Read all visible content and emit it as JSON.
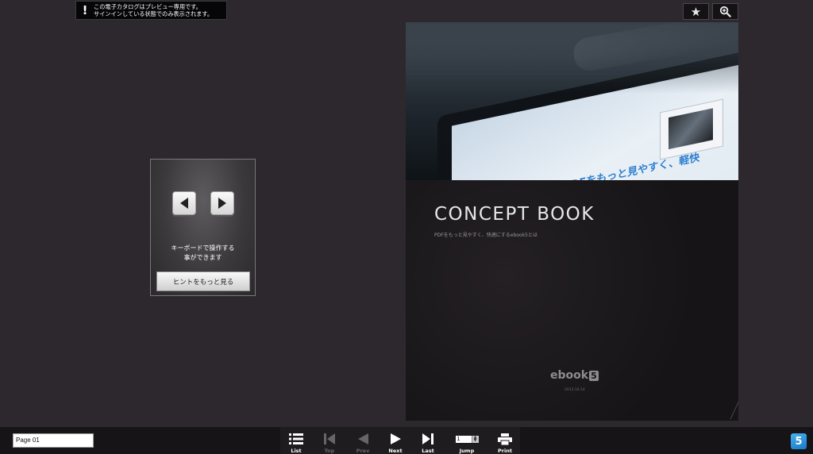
{
  "notice": {
    "icon": "exclamation-icon",
    "line1": "この電子カタログはプレビュー専用です。",
    "line2": "サインインしている状態でのみ表示されます。"
  },
  "topbar": {
    "bookmark_icon": "star-icon",
    "zoom_icon": "zoom-in-icon"
  },
  "book": {
    "photo_text": "PDFをもっと見やすく、軽快",
    "cover_title": "CONCEPT BOOK",
    "cover_subtitle": "PDFをもっと見やすく、快適にするebook5とは",
    "cover_logo": "ebook",
    "cover_logo_num": "5",
    "cover_date": "2013.10.14"
  },
  "hint": {
    "left_key_icon": "arrow-left-key-icon",
    "right_key_icon": "arrow-right-key-icon",
    "text": "キーボードで操作する\n事ができます",
    "button_label": "ヒントをもっと見る"
  },
  "bottombar": {
    "page_field_value": "Page 01",
    "controls": {
      "list": "List",
      "top": "Top",
      "prev": "Prev",
      "next": "Next",
      "last": "Last",
      "jump": "Jump",
      "jump_value": "1",
      "print": "Print"
    },
    "brand_badge": "5"
  },
  "colors": {
    "background": "#2d282e",
    "bottombar": "#161416",
    "brand_blue": "#2a8fdc",
    "disabled": "#666666"
  }
}
